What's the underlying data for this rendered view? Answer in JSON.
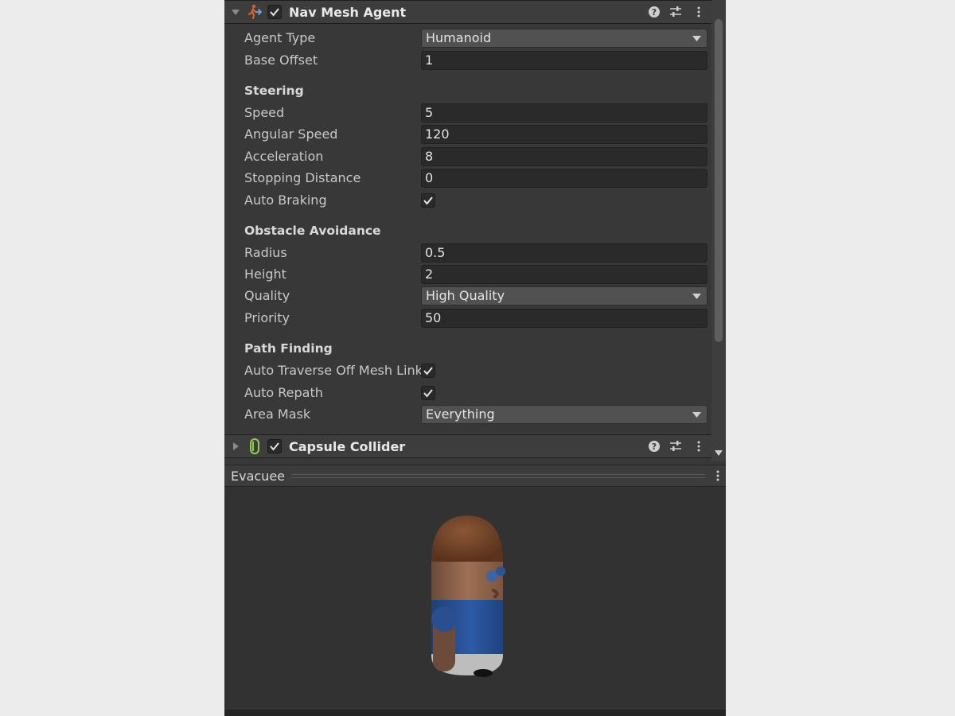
{
  "components": {
    "nav_mesh_agent": {
      "title": "Nav Mesh Agent",
      "enabled": true,
      "expanded": true
    },
    "capsule_collider": {
      "title": "Capsule Collider",
      "enabled": true,
      "expanded": false
    }
  },
  "agent": {
    "agent_type": {
      "label": "Agent Type",
      "value": "Humanoid"
    },
    "base_offset": {
      "label": "Base Offset",
      "value": "1"
    }
  },
  "steering": {
    "title": "Steering",
    "speed": {
      "label": "Speed",
      "value": "5"
    },
    "angular_speed": {
      "label": "Angular Speed",
      "value": "120"
    },
    "acceleration": {
      "label": "Acceleration",
      "value": "8"
    },
    "stopping_distance": {
      "label": "Stopping Distance",
      "value": "0"
    },
    "auto_braking": {
      "label": "Auto Braking",
      "checked": true
    }
  },
  "obstacle_avoidance": {
    "title": "Obstacle Avoidance",
    "radius": {
      "label": "Radius",
      "value": "0.5"
    },
    "height": {
      "label": "Height",
      "value": "2"
    },
    "quality": {
      "label": "Quality",
      "value": "High Quality"
    },
    "priority": {
      "label": "Priority",
      "value": "50"
    }
  },
  "path_finding": {
    "title": "Path Finding",
    "auto_traverse": {
      "label": "Auto Traverse Off Mesh Link",
      "checked": true
    },
    "auto_repath": {
      "label": "Auto Repath",
      "checked": true
    },
    "area_mask": {
      "label": "Area Mask",
      "value": "Everything"
    }
  },
  "preview": {
    "title": "Evacuee"
  },
  "colors": {
    "panel_bg": "#383838",
    "field_bg": "#2a2a2a",
    "dropdown_bg": "#515151",
    "nav_agent_icon": "#e8612c",
    "collider_icon": "#8fd14f"
  },
  "icons": {
    "foldout_open": "triangle-down-icon",
    "foldout_closed": "triangle-right-icon",
    "help": "question-circle-icon",
    "presets": "sliders-icon",
    "menu": "kebab-icon"
  }
}
